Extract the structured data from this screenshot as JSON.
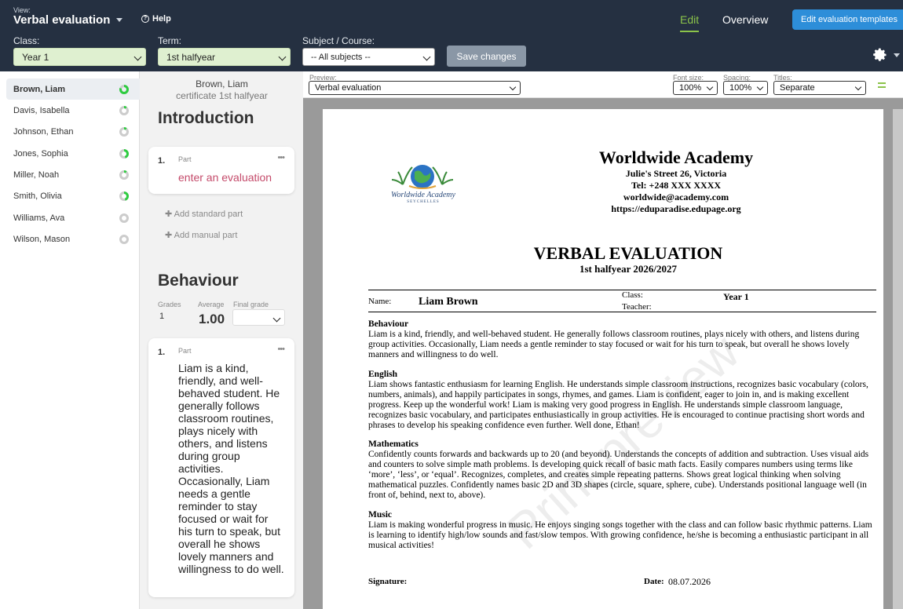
{
  "header": {
    "view_label": "View:",
    "view_title": "Verbal evaluation",
    "help": "Help",
    "tab_edit": "Edit",
    "tab_overview": "Overview",
    "templates_button": "Edit evaluation templates",
    "class_label": "Class:",
    "class_value": "Year 1",
    "term_label": "Term:",
    "term_value": "1st halfyear",
    "subject_label": "Subject / Course:",
    "subject_value": "-- All subjects --",
    "save_button": "Save changes"
  },
  "students": [
    {
      "name": "Brown, Liam",
      "active": true,
      "progress": 0.8
    },
    {
      "name": "Davis, Isabella",
      "active": false,
      "progress": 0.1
    },
    {
      "name": "Johnson, Ethan",
      "active": false,
      "progress": 0.1
    },
    {
      "name": "Jones, Sophia",
      "active": false,
      "progress": 0.45
    },
    {
      "name": "Miller, Noah",
      "active": false,
      "progress": 0.1
    },
    {
      "name": "Smith, Olivia",
      "active": false,
      "progress": 0.45
    },
    {
      "name": "Williams, Ava",
      "active": false,
      "progress": 0
    },
    {
      "name": "Wilson, Mason",
      "active": false,
      "progress": 0
    }
  ],
  "middle": {
    "student_name": "Brown, Liam",
    "certificate": "certificate 1st halfyear",
    "introduction": {
      "title": "Introduction",
      "part_number": "1.",
      "part_label": "Part",
      "placeholder": "enter an evaluation",
      "add_standard": "Add standard part",
      "add_manual": "Add manual part"
    },
    "behaviour": {
      "title": "Behaviour",
      "grades_label": "Grades",
      "grades_value": "1",
      "average_label": "Average",
      "average_value": "1.00",
      "final_label": "Final grade",
      "part_number": "1.",
      "part_label": "Part",
      "text": "Liam is a kind, friendly, and well-behaved student. He generally follows classroom routines, plays nicely with others, and listens during group activities. Occasionally, Liam needs a gentle reminder to stay focused or wait for his turn to speak, but overall he shows lovely manners and willingness to do well."
    }
  },
  "preview_toolbar": {
    "preview_label": "Preview:",
    "preview_value": "Verbal evaluation",
    "font_size_label": "Font size:",
    "font_size_value": "100%",
    "spacing_label": "Spacing:",
    "spacing_value": "100%",
    "titles_label": "Titles:",
    "titles_value": "Separate"
  },
  "document": {
    "school_name": "Worldwide Academy",
    "address": "Julie's Street 26, Victoria",
    "tel": "Tel:  +248 XXX XXXX",
    "email": "worldwide@academy.com",
    "website": "https://eduparadise.edupage.org",
    "logo_text": "Worldwide Academy",
    "logo_sub": "SEYCHELLES",
    "title": "VERBAL EVALUATION",
    "subtitle": "1st halfyear 2026/2027",
    "name_label": "Name:",
    "name_value": "Liam Brown",
    "class_label": "Class:",
    "class_value": "Year 1",
    "teacher_label": "Teacher:",
    "subjects": [
      {
        "title": "Behaviour",
        "text": "Liam is a kind, friendly, and well-behaved student. He generally follows classroom routines, plays nicely with others, and listens during group activities. Occasionally, Liam needs a gentle reminder to stay focused or wait for his turn to speak, but overall he shows lovely manners and willingness to do well."
      },
      {
        "title": "English",
        "text": "Liam shows fantastic enthusiasm for learning English. He understands simple classroom instructions, recognizes basic vocabulary (colors, numbers, animals), and happily participates in songs, rhymes, and games. Liam is confident, eager to join in, and is making excellent progress. Keep up the wonderful work! Liam is making very good progress in English. He understands simple classroom language, recognizes basic vocabulary, and participates enthusiastically in group activities. He is encouraged to continue practising short words and phrases to develop his speaking confidence even further. Well done, Ethan!"
      },
      {
        "title": "Mathematics",
        "text": "Confidently counts forwards and backwards up to 20 (and beyond). Understands the concepts of addition and subtraction. Uses visual aids and counters to solve simple math problems. Is developing quick recall of basic math facts. Easily compares numbers using terms like ‘more’, ‘less’, or ‘equal’. Recognizes, completes, and creates simple repeating patterns. Shows great logical thinking when solving mathematical puzzles. Confidently names basic 2D and 3D shapes (circle, square, sphere, cube). Understands positional language well (in front of, behind, next to, above)."
      },
      {
        "title": "Music",
        "text": "Liam is making wonderful progress in music. He enjoys singing songs together with the class and can follow basic rhythmic patterns. Liam is learning to identify high/low sounds and fast/slow tempos. With growing confidence, he/she is becoming a enthusiastic participant in all musical activities!"
      }
    ],
    "signature_label": "Signature:",
    "date_label": "Date:",
    "date_value": "08.07.2026",
    "watermark": "Print preview"
  },
  "colors": {
    "header_bg": "#253041",
    "accent_green": "#8bc34a",
    "primary_blue": "#2d8ed9",
    "progress_green": "#2ecc40"
  }
}
